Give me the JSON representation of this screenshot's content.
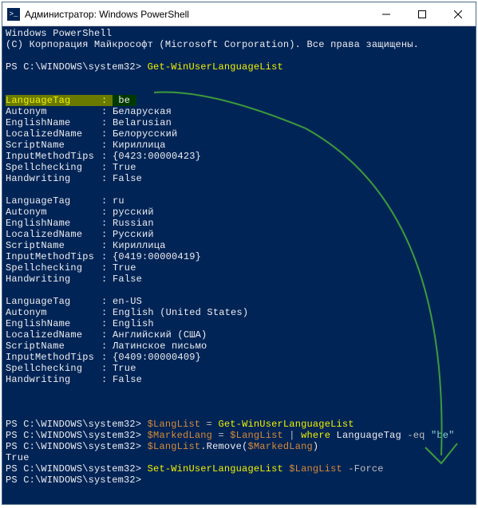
{
  "window": {
    "title": "Администратор: Windows PowerShell"
  },
  "header": {
    "line1": "Windows PowerShell",
    "line2": "(C) Корпорация Майкрософт (Microsoft Corporation). Все права защищены."
  },
  "prompt": "PS C:\\WINDOWS\\system32>",
  "cmd1": "Get-WinUserLanguageList",
  "langs": [
    {
      "LanguageTag": "be",
      "Autonym": "Беларуская",
      "EnglishName": "Belarusian",
      "LocalizedName": "Белорусский",
      "ScriptName": "Кириллица",
      "InputMethodTips": "{0423:00000423}",
      "Spellchecking": "True",
      "Handwriting": "False"
    },
    {
      "LanguageTag": "ru",
      "Autonym": "русский",
      "EnglishName": "Russian",
      "LocalizedName": "Русский",
      "ScriptName": "Кириллица",
      "InputMethodTips": "{0419:00000419}",
      "Spellchecking": "True",
      "Handwriting": "False"
    },
    {
      "LanguageTag": "en-US",
      "Autonym": "English (United States)",
      "EnglishName": "English",
      "LocalizedName": "Английский (США)",
      "ScriptName": "Латинское письмо",
      "InputMethodTips": "{0409:00000409}",
      "Spellchecking": "True",
      "Handwriting": "False"
    }
  ],
  "keys": [
    "LanguageTag",
    "Autonym",
    "EnglishName",
    "LocalizedName",
    "ScriptName",
    "InputMethodTips",
    "Spellchecking",
    "Handwriting"
  ],
  "cmds": {
    "l1_var": "$LangList",
    "l1_eq": " = ",
    "l1_cmd": "Get-WinUserLanguageList",
    "l2_var": "$MarkedLang",
    "l2_eq": " = ",
    "l2_v2": "$LangList",
    "l2_pipe": " | ",
    "l2_where": "where",
    "l2_tag": " LanguageTag ",
    "l2_eqop": "-eq ",
    "l2_val": "\"be\"",
    "l3_v1": "$LangList",
    "l3_dot": ".Remove(",
    "l3_v2": "$MarkedLang",
    "l3_close": ")",
    "l3_out": "True",
    "l4_cmd": "Set-WinUserLanguageList",
    "l4_var": " $LangList",
    "l4_flag": " -Force"
  }
}
